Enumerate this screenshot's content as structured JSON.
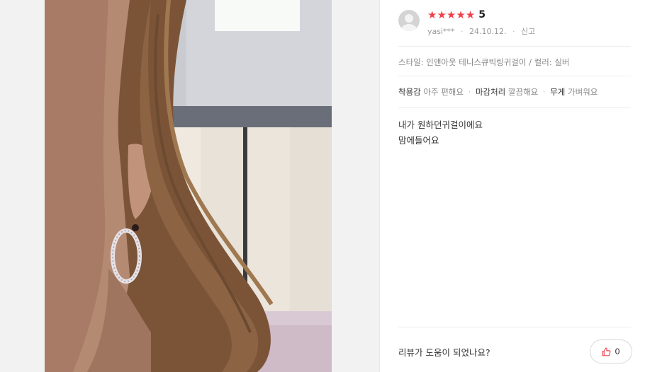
{
  "review": {
    "rating_display": "5",
    "rating_value": 5,
    "rating_max": 5,
    "user": "yasi***",
    "date": "24.10.12.",
    "report_label": "신고",
    "option": "스타일: 인앤아웃 테니스큐빅링귀걸이 / 컬러: 실버",
    "features": [
      {
        "key": "착용감",
        "value": "아주 편해요"
      },
      {
        "key": "마감처리",
        "value": "깔끔해요"
      },
      {
        "key": "무게",
        "value": "가벼워요"
      }
    ],
    "content_lines": [
      "내가 원하던귀걸이에요",
      "맘에들어요"
    ],
    "helpful_label": "리뷰가 도움이 되었나요?",
    "like_count": "0"
  },
  "colors": {
    "star": "#f0414a",
    "like_icon": "#f0414a"
  },
  "icons": {
    "star": "star-icon",
    "like": "thumbs-up-icon",
    "avatar": "default-avatar-icon"
  }
}
